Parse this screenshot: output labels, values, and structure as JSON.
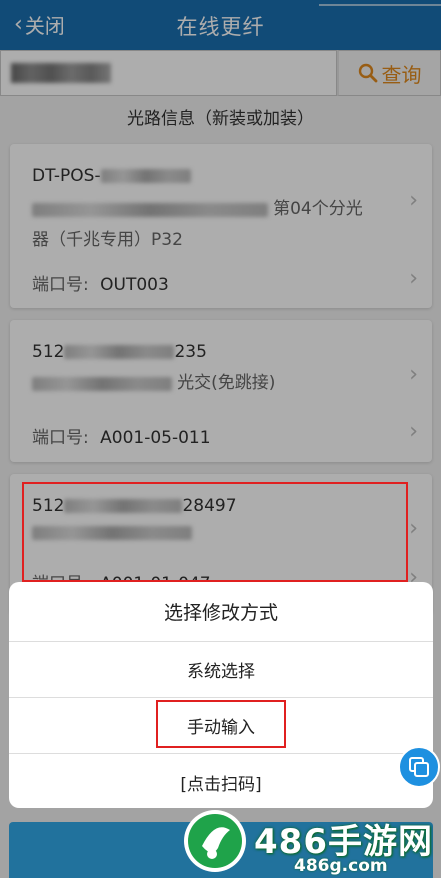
{
  "header": {
    "back_label": "关闭",
    "title": "在线更纤"
  },
  "search": {
    "button_label": "查询",
    "button_color": "#e08a1e"
  },
  "section_title": "光路信息（新装或加装）",
  "cards": [
    {
      "line1": "DT-POS-",
      "line2_suffix": "第04个分光",
      "line3": "器（千兆专用）P32",
      "port_label": "端口号:",
      "port_value": "OUT003"
    },
    {
      "line1_prefix": "512",
      "line1_suffix": "235",
      "line2_suffix": "光交(免跳接)",
      "port_label": "端口号:",
      "port_value": "A001-05-011"
    },
    {
      "line1_prefix": "512",
      "line1_suffix": "28497",
      "port_label": "端口号:",
      "port_value": "A001-01-047"
    }
  ],
  "sheet": {
    "title": "选择修改方式",
    "options": [
      "系统选择",
      "手动输入",
      "[点击扫码]"
    ]
  },
  "watermark": {
    "main": "486手游网",
    "sub": "486g.com"
  },
  "colors": {
    "header_bg": "#1a6fb0",
    "highlight_red": "#e02020",
    "bottom_button": "#32a8e8"
  }
}
